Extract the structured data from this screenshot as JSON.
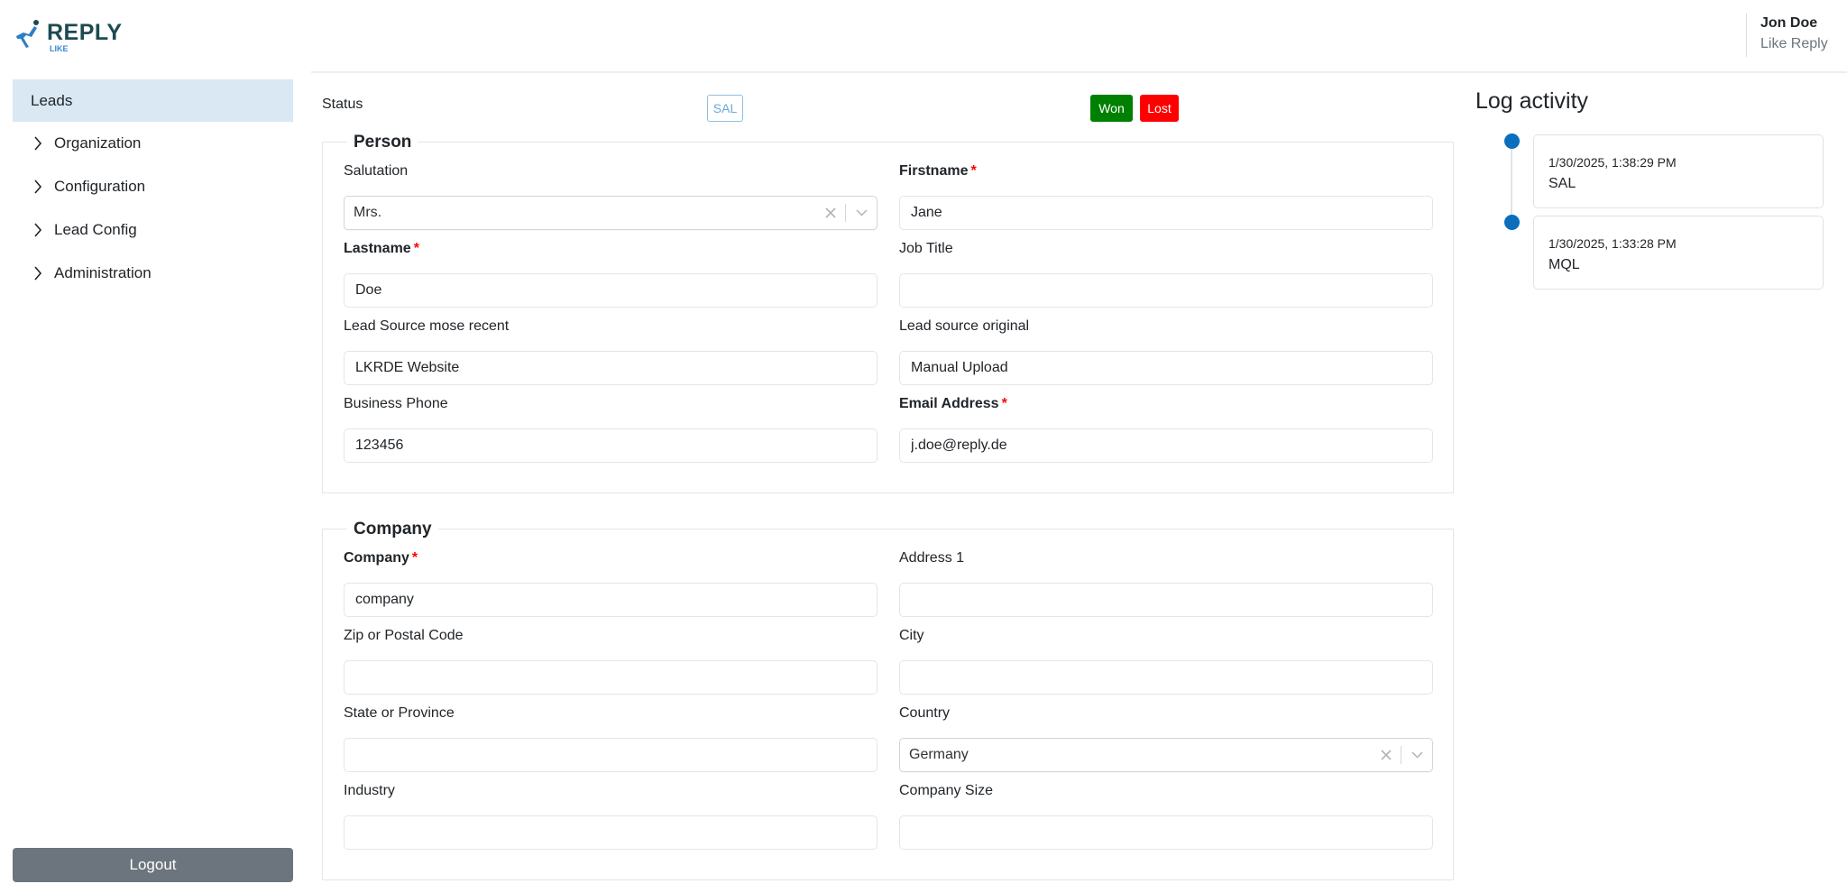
{
  "brand": {
    "name": "REPLY",
    "sub": "LIKE"
  },
  "sidebar": {
    "items": [
      {
        "label": "Leads",
        "active": true,
        "icon": "none"
      },
      {
        "label": "Organization",
        "active": false,
        "icon": "chevron-right-icon"
      },
      {
        "label": "Configuration",
        "active": false,
        "icon": "chevron-right-icon"
      },
      {
        "label": "Lead Config",
        "active": false,
        "icon": "chevron-right-icon"
      },
      {
        "label": "Administration",
        "active": false,
        "icon": "chevron-right-icon"
      }
    ],
    "logout_label": "Logout"
  },
  "user": {
    "name": "Jon Doe",
    "org": "Like Reply"
  },
  "status": {
    "label": "Status",
    "current": "SAL",
    "won_label": "Won",
    "lost_label": "Lost",
    "colors": {
      "won": "#008000",
      "lost": "#ff0000",
      "badge": "#6aa9d6"
    }
  },
  "person": {
    "legend": "Person",
    "salutation": {
      "label": "Salutation",
      "value": "Mrs.",
      "required": false
    },
    "firstname": {
      "label": "Firstname",
      "value": "Jane",
      "required": true
    },
    "lastname": {
      "label": "Lastname",
      "value": "Doe",
      "required": true
    },
    "job_title": {
      "label": "Job Title",
      "value": "",
      "required": false
    },
    "lead_source_recent": {
      "label": "Lead Source mose recent",
      "value": "LKRDE Website",
      "required": false
    },
    "lead_source_original": {
      "label": "Lead source original",
      "value": "Manual Upload",
      "required": false
    },
    "business_phone": {
      "label": "Business Phone",
      "value": "123456",
      "required": false
    },
    "email": {
      "label": "Email Address",
      "value": "j.doe@reply.de",
      "required": true
    }
  },
  "company": {
    "legend": "Company",
    "company": {
      "label": "Company",
      "value": "company",
      "required": true
    },
    "address1": {
      "label": "Address 1",
      "value": "",
      "required": false
    },
    "zip": {
      "label": "Zip or Postal Code",
      "value": "",
      "required": false
    },
    "city": {
      "label": "City",
      "value": "",
      "required": false
    },
    "state": {
      "label": "State or Province",
      "value": "",
      "required": false
    },
    "country": {
      "label": "Country",
      "value": "Germany",
      "required": false
    },
    "industry": {
      "label": "Industry",
      "value": "",
      "required": false
    },
    "company_size": {
      "label": "Company Size",
      "value": "",
      "required": false
    }
  },
  "required_marker": "*",
  "log": {
    "title": "Log activity",
    "entries": [
      {
        "time": "1/30/2025, 1:38:29 PM",
        "status": "SAL"
      },
      {
        "time": "1/30/2025, 1:33:28 PM",
        "status": "MQL"
      }
    ],
    "accent": "#0a6ebd"
  }
}
